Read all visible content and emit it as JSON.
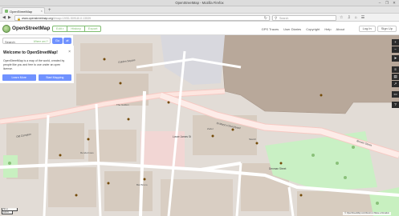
{
  "window": {
    "title": "OpenStreetMap - Mozilla Firefox",
    "buttons": [
      "–",
      "❐",
      "✕"
    ]
  },
  "tab": {
    "label": "OpenStreetMap",
    "close": "×",
    "new_tab": "+"
  },
  "nav": {
    "back": "◀",
    "forward": "▶",
    "url_host": "www.openstreetmap.org",
    "url_rest": "/#map=19/51.50918/-0.13539",
    "reload": "↻",
    "search_placeholder": "Search",
    "tool_icons": [
      "☆",
      "⇩",
      "⌂",
      "☰"
    ]
  },
  "osm_header": {
    "brand": "OpenStreetMap",
    "edit_buttons": [
      "Edit",
      "History",
      "Export"
    ],
    "nav_links": [
      "GPS Traces",
      "User Diaries",
      "Copyright",
      "Help",
      "About"
    ],
    "user_buttons": [
      "Log In",
      "Sign Up"
    ]
  },
  "sidebar": {
    "search_value": "Search",
    "where_label": "Where am I?",
    "go_label": "Go",
    "directions_icon": "⇄",
    "welcome": {
      "title": "Welcome to OpenStreetMap!",
      "close": "×",
      "body": "OpenStreetMap is a map of the world, created by people like you and free to use under an open license.",
      "learn_more": "Learn More",
      "start_mapping": "Start Mapping"
    }
  },
  "map": {
    "streets": [
      "Golden Square",
      "Brewer Street",
      "Old Compton",
      "Warwick St",
      "Denman Street",
      "St Mary's Churchyard",
      "Lower James St"
    ],
    "places": [
      "The Golden",
      "Zedel",
      "Sketch",
      "Rendezvous",
      "Bar Bruno"
    ]
  },
  "controls": [
    "+",
    "−",
    "➤",
    "≡",
    "▤",
    "↗",
    "▭",
    "?"
  ],
  "scale": [
    "50 m",
    "100 ft"
  ],
  "attribution": "© OpenStreetMap contributors ♥ Make a Donation"
}
